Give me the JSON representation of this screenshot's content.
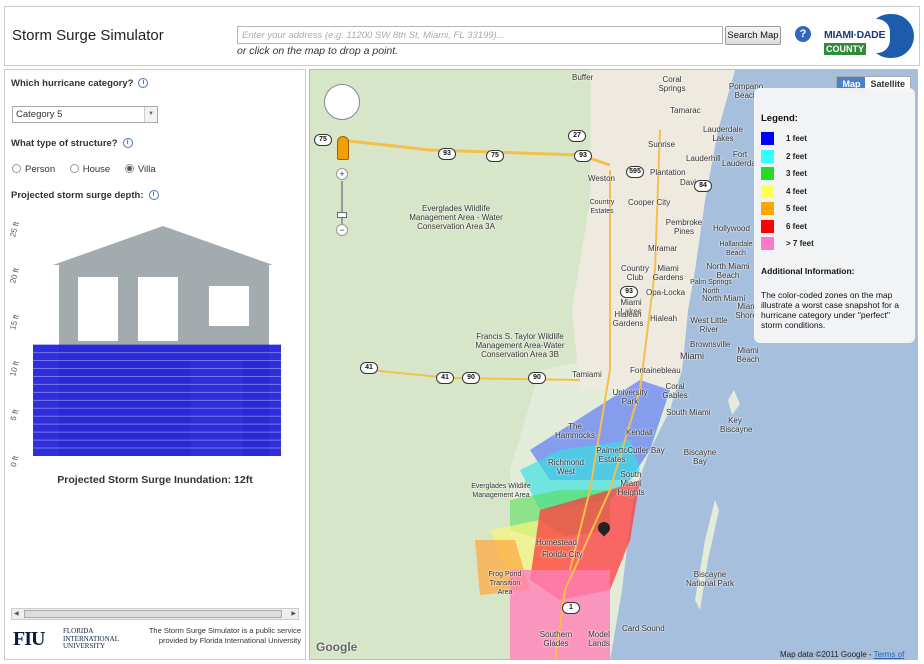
{
  "header": {
    "title": "Storm Surge Simulator",
    "address_placeholder": "Enter your address (e.g. 11200 SW 8th St, Miami, FL 33199)...",
    "search_button": "Search Map",
    "hint": "or click on the map to drop a point.",
    "help_icon": "?",
    "logo_line1": "MIAMI·DADE",
    "logo_line2": "COUNTY"
  },
  "left": {
    "category_question": "Which hurricane category?",
    "category_selected": "Category 5",
    "structure_question": "What type of structure?",
    "structure_options": [
      "Person",
      "House",
      "Villa"
    ],
    "structure_selected": "Villa",
    "depth_label": "Projected storm surge depth:",
    "inundation_text": "Projected Storm Surge Inundation: 12ft",
    "chart": {
      "y_ticks": [
        "25 ft",
        "20 ft",
        "15 ft",
        "10 ft",
        "5 ft",
        "0 ft"
      ],
      "surge_ft": 12,
      "max_ft": 25,
      "house_color": "#a3abae",
      "water_color": "#2323d8"
    },
    "fiu_mark": "FIU",
    "fiu_text": [
      "FLORIDA",
      "INTERNATIONAL",
      "UNIVERSITY"
    ],
    "footer_note": "The Storm Surge Simulator is a public service provided by Florida International University"
  },
  "map": {
    "type_buttons": [
      "Map",
      "Satellite"
    ],
    "type_active": "Map",
    "legend_title": "Legend:",
    "legend_items": [
      {
        "label": "1 feet",
        "color": "#0000ff"
      },
      {
        "label": "2 feet",
        "color": "#33ffff"
      },
      {
        "label": "3 feet",
        "color": "#22dd22"
      },
      {
        "label": "4 feet",
        "color": "#ffff55"
      },
      {
        "label": "5 feet",
        "color": "#ffa500"
      },
      {
        "label": "6 feet",
        "color": "#ff0000"
      },
      {
        "label": "> 7 feet",
        "color": "#ff77cc"
      }
    ],
    "additional_title": "Additional Information:",
    "additional_text": "The color-coded zones on the map illustrate a worst case snapshot for a hurricane category under \"perfect\" storm conditions.",
    "attribution": "Map data ©2011 Google -",
    "terms": "Terms of Use",
    "google": "Google",
    "places": [
      {
        "name": "Buffer",
        "id": "buffer"
      },
      {
        "name": "Pompano Beach",
        "id": "pompano"
      },
      {
        "name": "Coral Springs",
        "id": "coral-springs"
      },
      {
        "name": "Tamarac",
        "id": "tamarac"
      },
      {
        "name": "Lauderdale Lakes",
        "id": "lauderdale-lakes"
      },
      {
        "name": "Lauderhill",
        "id": "lauderhill"
      },
      {
        "name": "Sunrise",
        "id": "sunrise"
      },
      {
        "name": "Plantation",
        "id": "plantation"
      },
      {
        "name": "Fort Lauderdale",
        "id": "fort-lauderdale"
      },
      {
        "name": "Weston",
        "id": "weston"
      },
      {
        "name": "Davie",
        "id": "davie"
      },
      {
        "name": "Country Estates",
        "id": "country-estates"
      },
      {
        "name": "Cooper City",
        "id": "cooper-city"
      },
      {
        "name": "Pembroke Pines",
        "id": "pembroke-pines"
      },
      {
        "name": "Hollywood",
        "id": "hollywood"
      },
      {
        "name": "Hallandale Beach",
        "id": "hallandale"
      },
      {
        "name": "Miramar",
        "id": "miramar"
      },
      {
        "name": "Miami Gardens",
        "id": "miami-gardens"
      },
      {
        "name": "North Miami Beach",
        "id": "north-miami-beach"
      },
      {
        "name": "Country Club",
        "id": "country-club"
      },
      {
        "name": "Opa-Locka",
        "id": "opa-locka"
      },
      {
        "name": "North Miami",
        "id": "north-miami"
      },
      {
        "name": "Palm Springs North",
        "id": "palm-springs-north"
      },
      {
        "name": "Miami Lakes",
        "id": "miami-lakes"
      },
      {
        "name": "Hialeah Gardens",
        "id": "hialeah-gardens"
      },
      {
        "name": "Hialeah",
        "id": "hialeah"
      },
      {
        "name": "West Little River",
        "id": "west-little-river"
      },
      {
        "name": "Miami Shores",
        "id": "miami-shores"
      },
      {
        "name": "Brownsville",
        "id": "brownsville"
      },
      {
        "name": "Miami",
        "id": "miami"
      },
      {
        "name": "Miami Beach",
        "id": "miami-beach"
      },
      {
        "name": "Everglades Wildlife Management Area - Water Conservation Area 3A",
        "id": "ewma-3a"
      },
      {
        "name": "Francis S. Taylor Wildlife Management Area-Water Conservation Area 3B",
        "id": "ewma-3b"
      },
      {
        "name": "Tamiami",
        "id": "tamiami"
      },
      {
        "name": "Fontainebleau",
        "id": "fontainebleau"
      },
      {
        "name": "University Park",
        "id": "university-park"
      },
      {
        "name": "Coral Gables",
        "id": "coral-gables"
      },
      {
        "name": "Key Biscayne",
        "id": "key-biscayne"
      },
      {
        "name": "South Miami",
        "id": "south-miami"
      },
      {
        "name": "The Hammocks",
        "id": "hammocks"
      },
      {
        "name": "Kendall",
        "id": "kendall"
      },
      {
        "name": "Biscayne Bay",
        "id": "biscayne-bay"
      },
      {
        "name": "Richmond West",
        "id": "richmond-west"
      },
      {
        "name": "Palmetto Estates",
        "id": "palmetto-estates"
      },
      {
        "name": "Cutler Bay",
        "id": "cutler-bay"
      },
      {
        "name": "South Miami Heights",
        "id": "smh"
      },
      {
        "name": "Everglades Wildlife Management Area",
        "id": "ewma"
      },
      {
        "name": "Homestead",
        "id": "homestead"
      },
      {
        "name": "Florida City",
        "id": "florida-city"
      },
      {
        "name": "Frog Pond Transition Area",
        "id": "frog-pond"
      },
      {
        "name": "Biscayne National Park",
        "id": "biscayne-np"
      },
      {
        "name": "Southern Glades",
        "id": "southern-glades"
      },
      {
        "name": "Model Lands",
        "id": "model-lands"
      },
      {
        "name": "Card Sound",
        "id": "card-sound"
      }
    ],
    "shields": [
      "27",
      "75",
      "93",
      "75",
      "93",
      "595",
      "84",
      "93",
      "41",
      "41",
      "90",
      "90",
      "1"
    ]
  }
}
